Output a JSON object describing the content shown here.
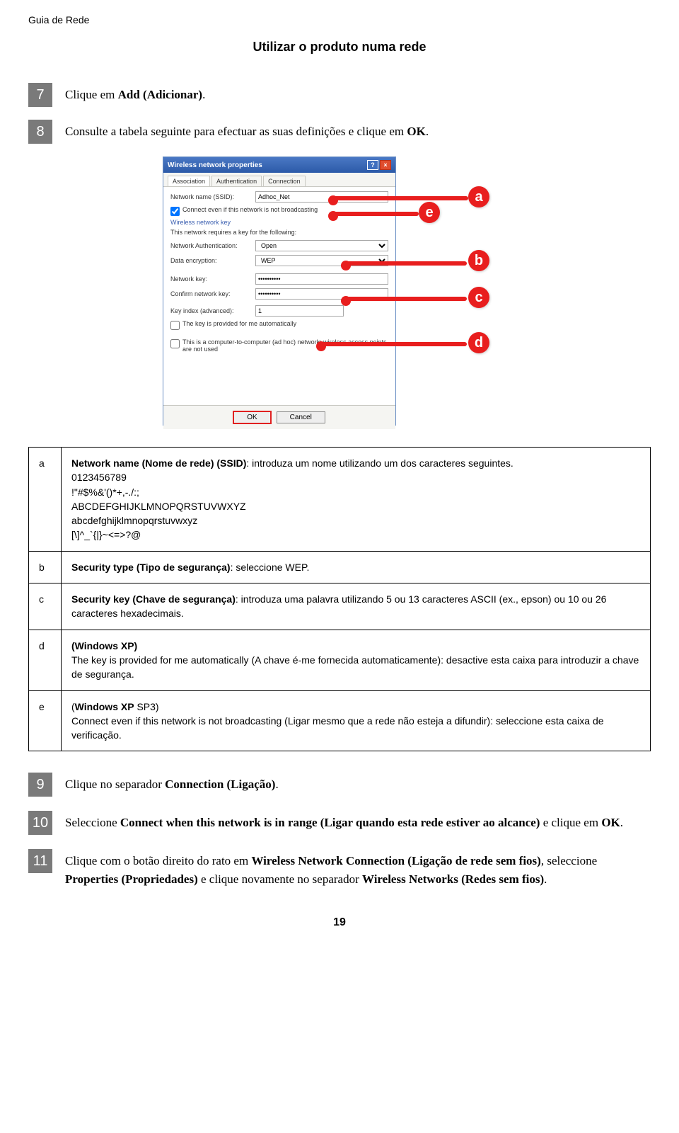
{
  "header": {
    "doc_title": "Guia de Rede"
  },
  "section_title": "Utilizar o produto numa rede",
  "steps": {
    "s7": {
      "num": "7",
      "pre": "Clique em ",
      "bold": "Add (Adicionar)",
      "post": "."
    },
    "s8": {
      "num": "8",
      "pre": "Consulte a tabela seguinte para efectuar as suas definições e clique em ",
      "bold": "OK",
      "post": "."
    },
    "s9": {
      "num": "9",
      "pre": "Clique no separador ",
      "bold": "Connection (Ligação)",
      "post": "."
    },
    "s10": {
      "num": "10",
      "pre": "Seleccione ",
      "bold": "Connect when this network is in range (Ligar quando esta rede estiver ao alcance)",
      "post": " e clique em ",
      "bold2": "OK",
      "post2": "."
    },
    "s11": {
      "num": "11",
      "pre": "Clique com o botão direito do rato em ",
      "bold": "Wireless Network Connection (Ligação de rede sem fios)",
      "mid": ", seleccione ",
      "bold2": "Properties (Propriedades)",
      "mid2": " e clique novamente no separador ",
      "bold3": "Wireless Networks (Redes sem fios)",
      "post": "."
    }
  },
  "dialog": {
    "title": "Wireless network properties",
    "help": "?",
    "close": "×",
    "tabs": {
      "t1": "Association",
      "t2": "Authentication",
      "t3": "Connection"
    },
    "ssid_label": "Network name (SSID):",
    "ssid_value": "Adhoc_Net",
    "connect_even": "Connect even if this network is not broadcasting",
    "wnk_label": "Wireless network key",
    "wnk_desc": "This network requires a key for the following:",
    "auth_label": "Network Authentication:",
    "auth_value": "Open",
    "enc_label": "Data encryption:",
    "enc_value": "WEP",
    "key_label": "Network key:",
    "key_value": "••••••••••",
    "key2_label": "Confirm network key:",
    "key2_value": "••••••••••",
    "keyidx_label": "Key index (advanced):",
    "keyidx_value": "1",
    "auto_key": "The key is provided for me automatically",
    "adhoc_note": "This is a computer-to-computer (ad hoc) network; wireless access points are not used",
    "ok": "OK",
    "cancel": "Cancel"
  },
  "callouts": {
    "a": "a",
    "b": "b",
    "c": "c",
    "d": "d",
    "e": "e"
  },
  "table": {
    "a": {
      "key": "a",
      "title": "Network name (Nome de rede) (SSID)",
      "colon_text": ": introduza um nome utilizando um dos caracteres seguintes.",
      "line2": "0123456789",
      "line3": "!\"#$%&'()*+,-./:;",
      "line4": "ABCDEFGHIJKLMNOPQRSTUVWXYZ",
      "line5": "abcdefghijklmnopqrstuvwxyz",
      "line6": "[\\]^_`{|}~<=>?@"
    },
    "b": {
      "key": "b",
      "title": "Security type (Tipo de segurança)",
      "colon_text": ": seleccione WEP."
    },
    "c": {
      "key": "c",
      "title": "Security key (Chave de segurança)",
      "colon_text": ": introduza uma palavra utilizando 5 ou 13 caracteres ASCII (ex., epson) ou 10 ou 26 caracteres hexadecimais."
    },
    "d": {
      "key": "d",
      "title": "(Windows XP)",
      "text": "The key is provided for me automatically (A chave é-me fornecida automaticamente): desactive esta caixa para introduzir a chave de segurança."
    },
    "e": {
      "key": "e",
      "title_pre": "(",
      "title_bold": "Windows XP",
      "title_post": " SP3)",
      "text": "Connect even if this network is not broadcasting (Ligar mesmo que a rede não esteja a difundir): seleccione esta caixa de verificação."
    }
  },
  "page_number": "19"
}
